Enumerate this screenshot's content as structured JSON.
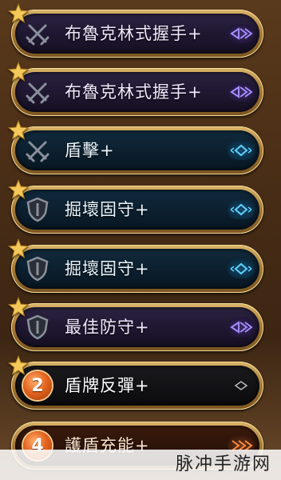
{
  "skills": [
    {
      "name": "布魯克林式握手+",
      "icon": "crossed-swords-icon",
      "theme": "purple"
    },
    {
      "name": "布魯克林式握手+",
      "icon": "crossed-swords-icon",
      "theme": "purple"
    },
    {
      "name": "盾擊+",
      "icon": "crossed-swords-icon",
      "theme": "blue"
    },
    {
      "name": "掘壞固守+",
      "icon": "shield-icon",
      "theme": "blue"
    },
    {
      "name": "掘壞固守+",
      "icon": "shield-icon",
      "theme": "blue"
    },
    {
      "name": "最佳防守+",
      "icon": "shield-icon",
      "theme": "purple"
    },
    {
      "name": "盾牌反彈+",
      "icon": "number-badge-icon",
      "badge": "2",
      "theme": "dark"
    },
    {
      "name": "護盾充能+",
      "icon": "number-badge-icon",
      "badge": "4",
      "theme": "orange"
    }
  ],
  "colors": {
    "gold_frame": "#c89a4c",
    "star": "#f5c85a",
    "purple_accent": "#9b7bff",
    "blue_accent": "#52c6ff",
    "orange_accent": "#ff8a3d"
  },
  "watermark": {
    "text": "脉冲手游网"
  }
}
